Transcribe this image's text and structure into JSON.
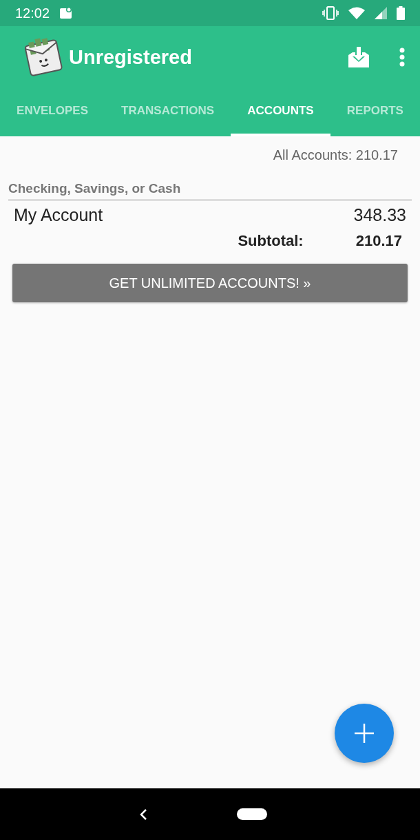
{
  "status_bar": {
    "time": "12:02"
  },
  "app_bar": {
    "title": "Unregistered"
  },
  "tabs": [
    {
      "label": "ENVELOPES",
      "selected": false
    },
    {
      "label": "TRANSACTIONS",
      "selected": false
    },
    {
      "label": "ACCOUNTS",
      "selected": true
    },
    {
      "label": "REPORTS",
      "selected": false
    }
  ],
  "all_accounts": "All Accounts: 210.17",
  "sections": [
    {
      "title": "Checking, Savings, or Cash",
      "accounts": [
        {
          "name": "My Account",
          "amount": "348.33"
        }
      ],
      "subtotal_label": "Subtotal:",
      "subtotal": "210.17"
    }
  ],
  "upgrade_button": "GET UNLIMITED ACCOUNTS! »"
}
